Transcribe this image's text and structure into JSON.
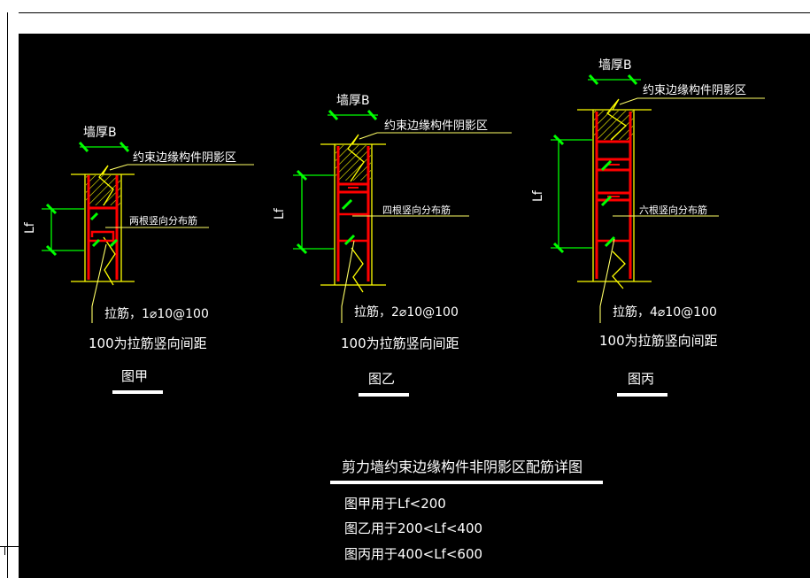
{
  "colors": {
    "background": "#000000",
    "wall": "#ffff00",
    "rebar": "#ff0000",
    "dimension": "#00ff00",
    "text": "#ffffff",
    "label_line": "#ffff66"
  },
  "details": [
    {
      "wall_thickness": "墙厚B",
      "shaded_zone": "约束边缘构件阴影区",
      "vertical_bars": "两根竖向分布筋",
      "lf": "Lf",
      "tie": "拉筋，1⌀10@100",
      "spacing_note": "100为拉筋竖向间距",
      "caption": "图甲"
    },
    {
      "wall_thickness": "墙厚B",
      "shaded_zone": "约束边缘构件阴影区",
      "vertical_bars": "四根竖向分布筋",
      "lf": "Lf",
      "tie": "拉筋，2⌀10@100",
      "spacing_note": "100为拉筋竖向间距",
      "caption": "图乙"
    },
    {
      "wall_thickness": "墙厚B",
      "shaded_zone": "约束边缘构件阴影区",
      "vertical_bars": "六根竖向分布筋",
      "lf": "Lf",
      "tie": "拉筋，4⌀10@100",
      "spacing_note": "100为拉筋竖向间距",
      "caption": "图丙"
    }
  ],
  "summary": {
    "title": "剪力墙约束边缘构件非阴影区配筋详图",
    "rules": [
      "图甲用于Lf<200",
      "图乙用于200<Lf<400",
      "图丙用于400<Lf<600"
    ]
  }
}
